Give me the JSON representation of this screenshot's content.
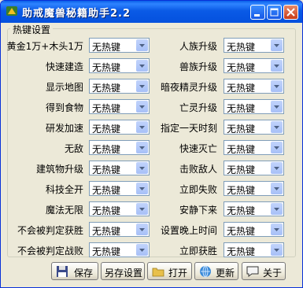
{
  "window": {
    "title": "助戒魔兽秘籍助手2.2",
    "buttons": [
      "minimize",
      "maximize",
      "close"
    ]
  },
  "group_title": "热键设置",
  "left_items": [
    {
      "label": "黄金1万+木头1万",
      "value": "无热键"
    },
    {
      "label": "快速建造",
      "value": "无热键"
    },
    {
      "label": "显示地图",
      "value": "无热键"
    },
    {
      "label": "得到食物",
      "value": "无热键"
    },
    {
      "label": "研发加速",
      "value": "无热键"
    },
    {
      "label": "无敌",
      "value": "无热键"
    },
    {
      "label": "建筑物升级",
      "value": "无热键"
    },
    {
      "label": "科技全开",
      "value": "无热键"
    },
    {
      "label": "魔法无限",
      "value": "无热键"
    },
    {
      "label": "不会被判定获胜",
      "value": "无热键"
    },
    {
      "label": "不会被判定战败",
      "value": "无热键"
    }
  ],
  "right_items": [
    {
      "label": "人族升级",
      "value": "无热键"
    },
    {
      "label": "兽族升级",
      "value": "无热键"
    },
    {
      "label": "暗夜精灵升级",
      "value": "无热键"
    },
    {
      "label": "亡灵升级",
      "value": "无热键"
    },
    {
      "label": "指定一天时刻",
      "value": "无热键"
    },
    {
      "label": "快速灭亡",
      "value": "无热键"
    },
    {
      "label": "击败敌人",
      "value": "无热键"
    },
    {
      "label": "立即失败",
      "value": "无热键"
    },
    {
      "label": "安静下来",
      "value": "无热键"
    },
    {
      "label": "设置晚上时间",
      "value": "无热键"
    },
    {
      "label": "立即获胜",
      "value": "无热键"
    }
  ],
  "bottom_buttons": [
    {
      "label": "保存",
      "icon": "floppy-disk-icon"
    },
    {
      "label": "另存设置",
      "icon": ""
    },
    {
      "label": "打开",
      "icon": "open-folder-icon"
    },
    {
      "label": "更新",
      "icon": "globe-update-icon"
    },
    {
      "label": "关于",
      "icon": "speech-bubble-icon"
    }
  ]
}
